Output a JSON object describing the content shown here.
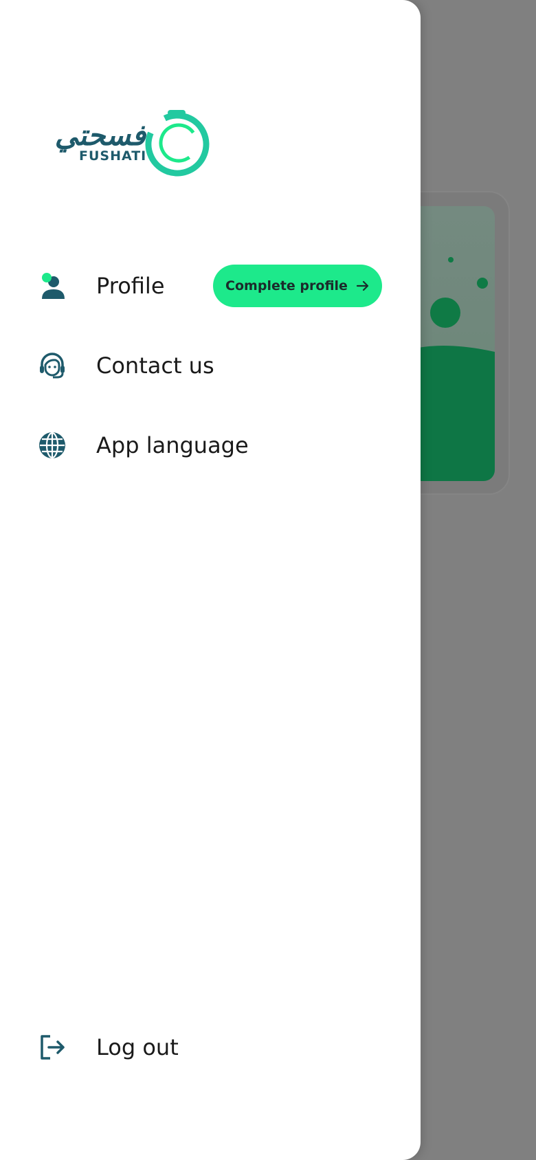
{
  "brand": {
    "name_ar": "فسحتي",
    "name_en": "FUSHATI",
    "primary_color": "#1e5a6b",
    "accent_color": "#1de98b"
  },
  "menu": {
    "items": [
      {
        "label": "Profile",
        "icon": "profile-icon"
      },
      {
        "label": "Contact us",
        "icon": "headset-icon"
      },
      {
        "label": "App language",
        "icon": "globe-icon"
      }
    ],
    "complete_profile_label": "Complete profile",
    "logout_label": "Log out",
    "logout_icon": "logout-icon"
  },
  "overlay_color": "#808080"
}
